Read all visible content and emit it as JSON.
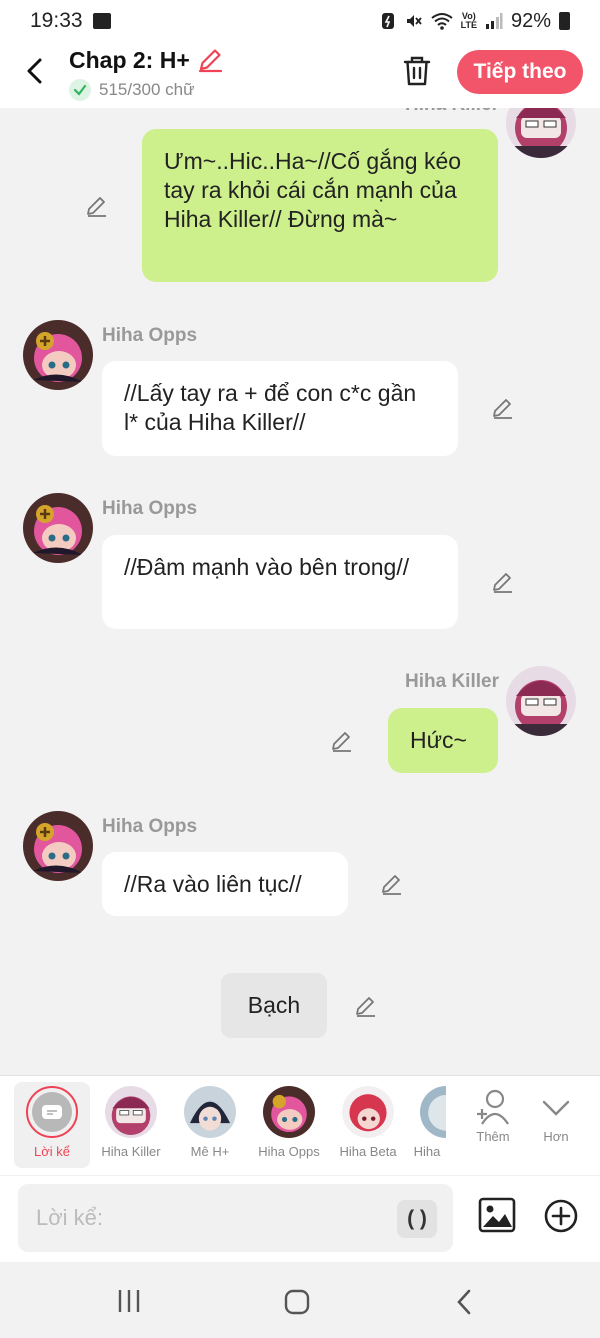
{
  "status_bar": {
    "time": "19:33",
    "battery": "92%",
    "lte": "Vo)\nLTE"
  },
  "header": {
    "title": "Chap 2: H+",
    "word_count": "515/300 chữ",
    "next_label": "Tiếp theo"
  },
  "messages": {
    "m1": {
      "speaker": "Hiha Killer",
      "side": "right",
      "text": "Ưm~..Hic..Ha~//Cố gắng kéo tay ra khỏi cái cắn mạnh của Hiha Killer// Đừng mà~"
    },
    "m2": {
      "speaker": "Hiha Opps",
      "side": "left",
      "text": "//Lấy tay ra + để con c*c gần l* của Hiha Killer//"
    },
    "m3": {
      "speaker": "Hiha Opps",
      "side": "left",
      "text": "//Đâm mạnh vào bên trong//"
    },
    "m4": {
      "speaker": "Hiha Killer",
      "side": "right",
      "text": "Hức~"
    },
    "m5": {
      "speaker": "Hiha Opps",
      "side": "left",
      "text": "//Ra vào liên tục//"
    },
    "m6": {
      "speaker": "",
      "side": "center",
      "text": "Bạch"
    }
  },
  "characters": [
    {
      "label": "Lời kể",
      "selected": true
    },
    {
      "label": "Hiha Killer"
    },
    {
      "label": "Mê H+"
    },
    {
      "label": "Hiha Opps"
    },
    {
      "label": "Hiha Beta"
    },
    {
      "label": "Hiha"
    }
  ],
  "actions": {
    "add_label": "Thêm",
    "more_label": "Hơn"
  },
  "composer": {
    "placeholder": "Lời kể:",
    "paren_label": "( )"
  },
  "colors": {
    "accent": "#f2556a",
    "right_bubble": "#cdf08c",
    "left_bubble": "#ffffff",
    "background": "#f2f2f2"
  }
}
